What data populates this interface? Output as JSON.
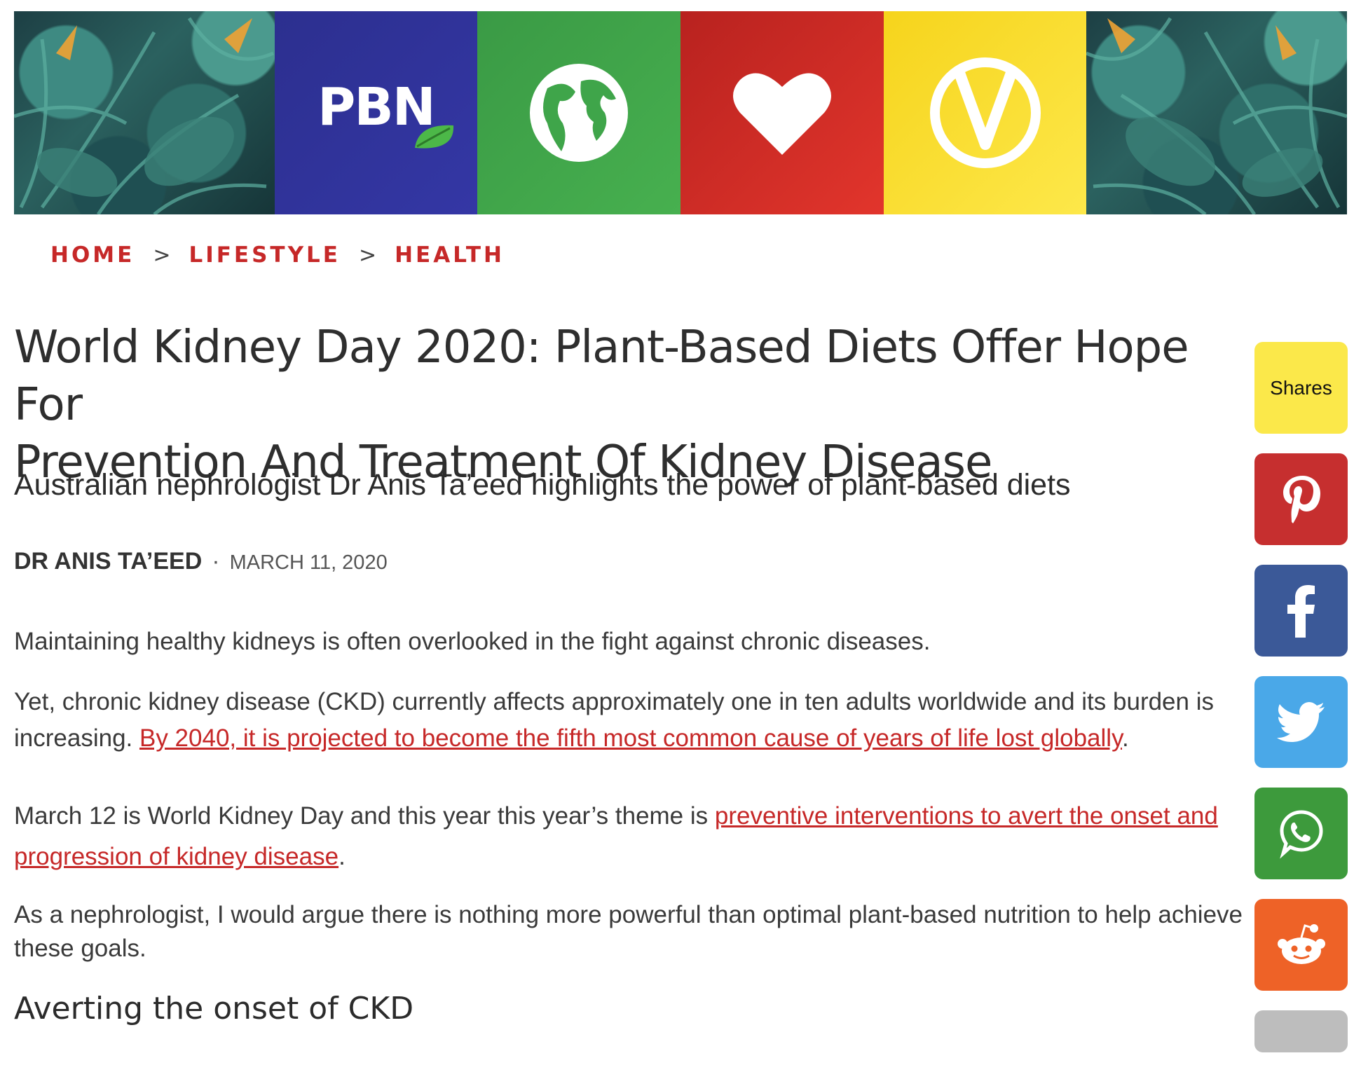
{
  "banner": {
    "logo_text": "PBN",
    "icons": [
      "leaf-icon",
      "globe-icon",
      "heart-icon",
      "v-circle-icon"
    ],
    "colors": {
      "blue": "#2c2f8f",
      "green": "#47b04f",
      "red": "#e2352c",
      "yellow": "#fde84a"
    }
  },
  "breadcrumb": {
    "items": [
      "HOME",
      "LIFESTYLE",
      "HEALTH"
    ],
    "separator": ">"
  },
  "article": {
    "title_line1": "World Kidney Day 2020: Plant-Based Diets Offer Hope For",
    "title_line2": "Prevention And Treatment Of Kidney Disease",
    "subtitle": "Australian nephrologist Dr Anis Ta’eed highlights the power of plant-based diets",
    "author": "DR ANIS TA’EED",
    "byline_dot": "·",
    "date": "MARCH 11, 2020",
    "p1": "Maintaining healthy kidneys is often overlooked in the fight against chronic diseases.",
    "p2_line1": "Yet, chronic kidney disease (CKD) currently affects approximately one in ten adults worldwide and its burden is",
    "p2_line2_text": "increasing. ",
    "p2_link": "By 2040, it is projected to become the fifth most common cause of years of life lost globally",
    "p2_end": ".",
    "p3_text": "March 12 is World Kidney Day and this year this year’s theme is ",
    "p3_link_line1": "preventive interventions to avert the onset and",
    "p3_link_line2": "progression of kidney disease",
    "p3_end": ".",
    "p4_line1": " As a nephrologist, I would argue there is nothing more powerful than optimal plant-based nutrition to help achieve",
    "p4_line2": "these goals.",
    "section_heading": "Averting the onset of CKD"
  },
  "share_bar": {
    "shares_label": "Shares",
    "buttons": [
      {
        "name": "pinterest",
        "icon": "pinterest-icon",
        "color": "#c62f2f"
      },
      {
        "name": "facebook",
        "icon": "facebook-icon",
        "color": "#3b5998"
      },
      {
        "name": "twitter",
        "icon": "twitter-icon",
        "color": "#4aa8e8"
      },
      {
        "name": "whatsapp",
        "icon": "whatsapp-icon",
        "color": "#3d9a3c"
      },
      {
        "name": "reddit",
        "icon": "reddit-icon",
        "color": "#ee6227"
      }
    ],
    "shares_color": "#fbe84a"
  }
}
